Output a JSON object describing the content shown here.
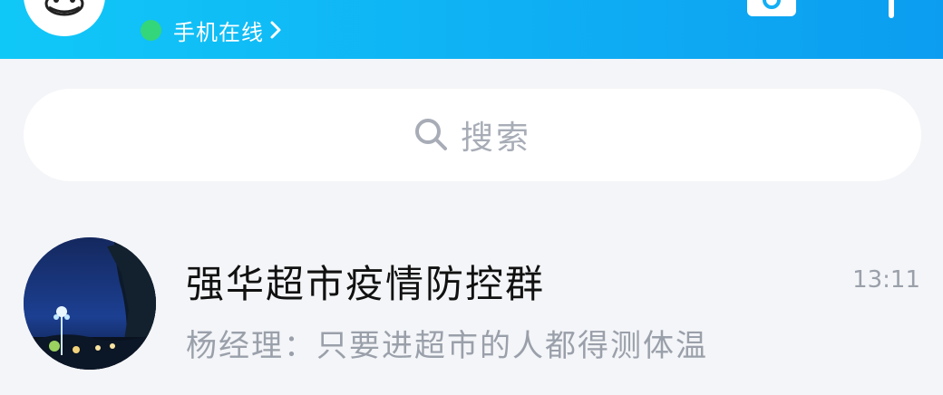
{
  "header": {
    "status_text": "手机在线",
    "status_color": "#33d67a",
    "gradient": [
      "#10c8f8",
      "#0c9df0"
    ],
    "icons": [
      "avatar-icon",
      "camera-icon",
      "plus-icon",
      "chevron-right-icon"
    ]
  },
  "search": {
    "placeholder": "搜索",
    "icon": "search-icon"
  },
  "chats": [
    {
      "title": "强华超市疫情防控群",
      "time": "13:11",
      "preview": "杨经理：只要进超市的人都得测体温"
    }
  ]
}
